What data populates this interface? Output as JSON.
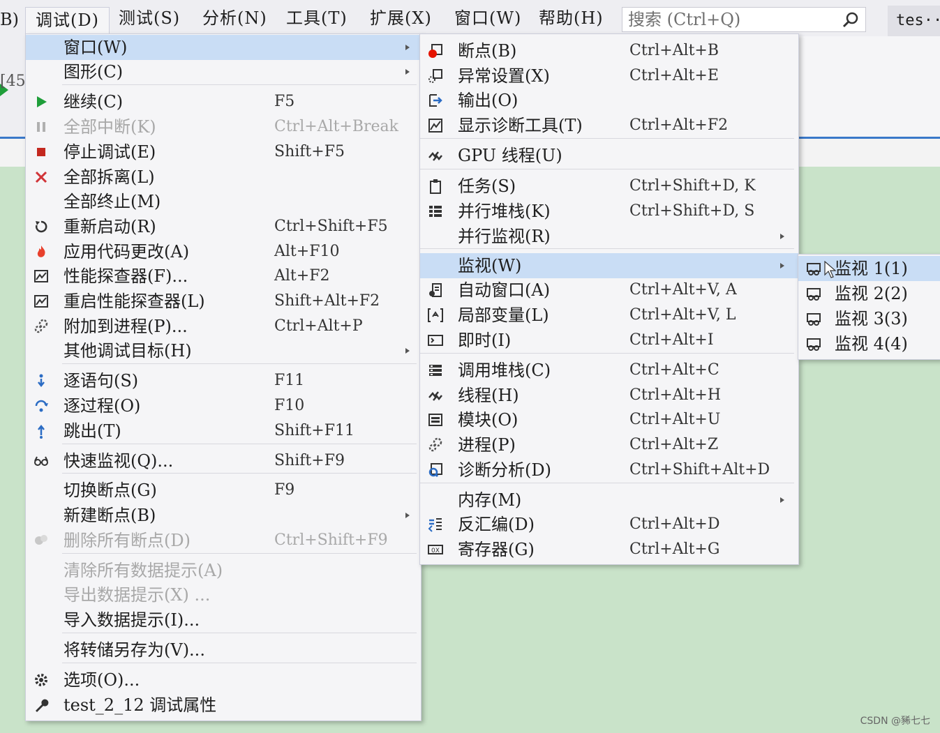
{
  "menubar": {
    "edge_text": "B)",
    "debug": "调试(D)",
    "test": "测试(S)",
    "analyze": "分析(N)",
    "tools": "工具(T)",
    "extensions": "扩展(X)",
    "window": "窗口(W)",
    "help": "帮助(H)",
    "search_placeholder": "搜索 (Ctrl+Q)",
    "account": "tes···"
  },
  "editor": {
    "bracket_text": "[45"
  },
  "debug_menu": {
    "items": [
      {
        "label": "窗口(W)",
        "shortcut": "",
        "icon": "",
        "submenu": true,
        "enabled": true,
        "highlight": true
      },
      {
        "label": "图形(C)",
        "shortcut": "",
        "icon": "",
        "submenu": true,
        "enabled": true
      },
      {
        "label": "继续(C)",
        "shortcut": "F5",
        "icon": "continue-icon",
        "enabled": true
      },
      {
        "label": "全部中断(K)",
        "shortcut": "Ctrl+Alt+Break",
        "icon": "pause-icon",
        "enabled": false
      },
      {
        "label": "停止调试(E)",
        "shortcut": "Shift+F5",
        "icon": "stop-icon",
        "enabled": true
      },
      {
        "label": "全部拆离(L)",
        "shortcut": "",
        "icon": "detach-icon",
        "enabled": true
      },
      {
        "label": "全部终止(M)",
        "shortcut": "",
        "icon": "",
        "enabled": true
      },
      {
        "label": "重新启动(R)",
        "shortcut": "Ctrl+Shift+F5",
        "icon": "restart-icon",
        "enabled": true
      },
      {
        "label": "应用代码更改(A)",
        "shortcut": "Alt+F10",
        "icon": "hot-reload-icon",
        "enabled": true
      },
      {
        "label": "性能探查器(F)...",
        "shortcut": "Alt+F2",
        "icon": "profiler-icon",
        "enabled": true
      },
      {
        "label": "重启性能探查器(L)",
        "shortcut": "Shift+Alt+F2",
        "icon": "profiler-icon",
        "enabled": true
      },
      {
        "label": "附加到进程(P)...",
        "shortcut": "Ctrl+Alt+P",
        "icon": "attach-icon",
        "enabled": true
      },
      {
        "label": "其他调试目标(H)",
        "shortcut": "",
        "icon": "",
        "submenu": true,
        "enabled": true
      },
      {
        "label": "逐语句(S)",
        "shortcut": "F11",
        "icon": "step-into-icon",
        "enabled": true
      },
      {
        "label": "逐过程(O)",
        "shortcut": "F10",
        "icon": "step-over-icon",
        "enabled": true
      },
      {
        "label": "跳出(T)",
        "shortcut": "Shift+F11",
        "icon": "step-out-icon",
        "enabled": true
      },
      {
        "label": "快速监视(Q)...",
        "shortcut": "Shift+F9",
        "icon": "quickwatch-icon",
        "enabled": true
      },
      {
        "label": "切换断点(G)",
        "shortcut": "F9",
        "icon": "",
        "enabled": true
      },
      {
        "label": "新建断点(B)",
        "shortcut": "",
        "icon": "",
        "submenu": true,
        "enabled": true
      },
      {
        "label": "删除所有断点(D)",
        "shortcut": "Ctrl+Shift+F9",
        "icon": "delete-breakpoints-icon",
        "enabled": false
      },
      {
        "label": "清除所有数据提示(A)",
        "shortcut": "",
        "icon": "",
        "enabled": false
      },
      {
        "label": "导出数据提示(X) ...",
        "shortcut": "",
        "icon": "",
        "enabled": false
      },
      {
        "label": "导入数据提示(I)...",
        "shortcut": "",
        "icon": "",
        "enabled": true
      },
      {
        "label": "将转储另存为(V)...",
        "shortcut": "",
        "icon": "",
        "enabled": true
      },
      {
        "label": "选项(O)...",
        "shortcut": "",
        "icon": "gear-icon",
        "enabled": true
      },
      {
        "label": "test_2_12 调试属性",
        "shortcut": "",
        "icon": "wrench-icon",
        "enabled": true
      }
    ]
  },
  "window_menu": {
    "items": [
      {
        "label": "断点(B)",
        "shortcut": "Ctrl+Alt+B",
        "icon": "breakpoint-window-icon"
      },
      {
        "label": "异常设置(X)",
        "shortcut": "Ctrl+Alt+E",
        "icon": "exception-settings-icon"
      },
      {
        "label": "输出(O)",
        "shortcut": "",
        "icon": "output-icon"
      },
      {
        "label": "显示诊断工具(T)",
        "shortcut": "Ctrl+Alt+F2",
        "icon": "diagnostics-icon"
      },
      {
        "label": "GPU 线程(U)",
        "shortcut": "",
        "icon": "gpu-threads-icon"
      },
      {
        "label": "任务(S)",
        "shortcut": "Ctrl+Shift+D, K",
        "icon": "tasks-icon"
      },
      {
        "label": "并行堆栈(K)",
        "shortcut": "Ctrl+Shift+D, S",
        "icon": "parallel-stacks-icon"
      },
      {
        "label": "并行监视(R)",
        "shortcut": "",
        "icon": "",
        "submenu": true
      },
      {
        "label": "监视(W)",
        "shortcut": "",
        "icon": "",
        "submenu": true,
        "highlight": true
      },
      {
        "label": "自动窗口(A)",
        "shortcut": "Ctrl+Alt+V, A",
        "icon": "autos-icon"
      },
      {
        "label": "局部变量(L)",
        "shortcut": "Ctrl+Alt+V, L",
        "icon": "locals-icon"
      },
      {
        "label": "即时(I)",
        "shortcut": "Ctrl+Alt+I",
        "icon": "immediate-icon"
      },
      {
        "label": "调用堆栈(C)",
        "shortcut": "Ctrl+Alt+C",
        "icon": "call-stack-icon"
      },
      {
        "label": "线程(H)",
        "shortcut": "Ctrl+Alt+H",
        "icon": "threads-icon"
      },
      {
        "label": "模块(O)",
        "shortcut": "Ctrl+Alt+U",
        "icon": "modules-icon"
      },
      {
        "label": "进程(P)",
        "shortcut": "Ctrl+Alt+Z",
        "icon": "processes-icon"
      },
      {
        "label": "诊断分析(D)",
        "shortcut": "Ctrl+Shift+Alt+D",
        "icon": "diagnostic-analysis-icon"
      },
      {
        "label": "内存(M)",
        "shortcut": "",
        "icon": "",
        "submenu": true
      },
      {
        "label": "反汇编(D)",
        "shortcut": "Ctrl+Alt+D",
        "icon": "disassembly-icon"
      },
      {
        "label": "寄存器(G)",
        "shortcut": "Ctrl+Alt+G",
        "icon": "registers-icon"
      }
    ]
  },
  "watch_menu": {
    "items": [
      {
        "label": "监视 1(1)",
        "icon": "watch-icon",
        "highlight": true
      },
      {
        "label": "监视 2(2)",
        "icon": "watch-icon"
      },
      {
        "label": "监视 3(3)",
        "icon": "watch-icon"
      },
      {
        "label": "监视 4(4)",
        "icon": "watch-icon"
      }
    ]
  },
  "watermark": "CSDN @豨七七",
  "colors": {
    "highlight": "#c9ddf5",
    "menu_bg": "#f5f5f7",
    "editor_bg": "#c9e3c9",
    "accent": "#3a78c9"
  }
}
